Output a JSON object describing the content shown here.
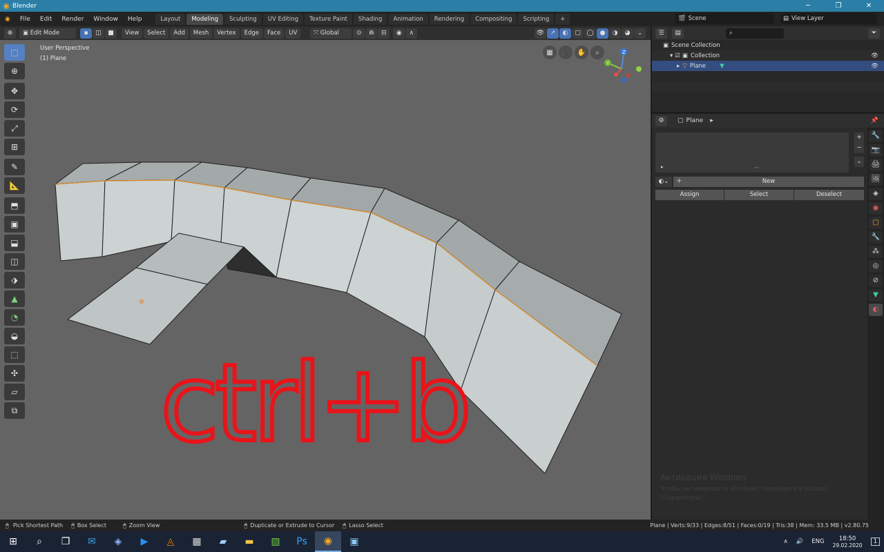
{
  "window": {
    "title": "Blender",
    "minimize": "─",
    "maximize": "❐",
    "close": "✕"
  },
  "menu": [
    "File",
    "Edit",
    "Render",
    "Window",
    "Help"
  ],
  "workspaces": [
    {
      "label": "Layout",
      "active": false
    },
    {
      "label": "Modeling",
      "active": true
    },
    {
      "label": "Sculpting",
      "active": false
    },
    {
      "label": "UV Editing",
      "active": false
    },
    {
      "label": "Texture Paint",
      "active": false
    },
    {
      "label": "Shading",
      "active": false
    },
    {
      "label": "Animation",
      "active": false
    },
    {
      "label": "Rendering",
      "active": false
    },
    {
      "label": "Compositing",
      "active": false
    },
    {
      "label": "Scripting",
      "active": false
    }
  ],
  "add_workspace": "+",
  "scene": {
    "name": "Scene",
    "view_layer": "View Layer"
  },
  "viewport_header": {
    "mode": "Edit Mode",
    "menus": [
      "View",
      "Select",
      "Add",
      "Mesh",
      "Vertex",
      "Edge",
      "Face",
      "UV"
    ],
    "orientation": "Global"
  },
  "viewport": {
    "view_name": "User Perspective",
    "object_name": "(1) Plane",
    "annotation_text": "ctrl+b",
    "annotation_color": "#e8141a",
    "gizmo": {
      "z": "Z",
      "y": "Y"
    }
  },
  "outliner": {
    "scene_collection": "Scene Collection",
    "collection": "Collection",
    "object": "Plane"
  },
  "properties": {
    "object": "Plane",
    "new_label": "New",
    "assign": "Assign",
    "select": "Select",
    "deselect": "Deselect",
    "plus": "+",
    "minus": "−"
  },
  "status": {
    "left1": "Pick Shortest Path",
    "left2": "Box Select",
    "left3": "Zoom View",
    "mid1": "Duplicate or Extrude to Cursor",
    "mid2": "Lasso Select",
    "stats": "Plane | Verts:9/33 | Edges:8/51 | Faces:0/19 | Tris:38 | Mem: 33.5 MB | v2.80.75"
  },
  "watermark": {
    "line1": "Активация Windows",
    "line2": "Чтобы активировать Windows, перейдите в раздел",
    "line3": "\"Параметры\"."
  },
  "tray": {
    "lang": "ENG",
    "time": "18:50",
    "date": "29.02.2020",
    "notif": "1"
  }
}
